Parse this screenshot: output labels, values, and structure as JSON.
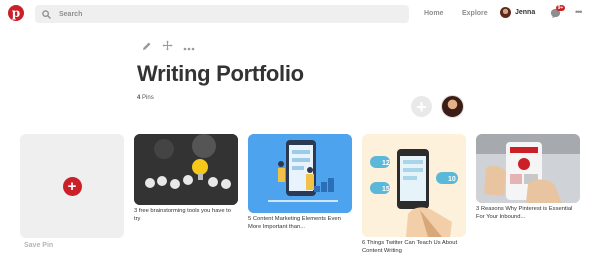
{
  "topbar": {
    "logo_letter": "p",
    "search_placeholder": "Search",
    "nav_home": "Home",
    "nav_explore": "Explore",
    "user_name": "Jenna",
    "notification_count": "9+",
    "more_glyph": "•••"
  },
  "board": {
    "title": "Writing Portfolio",
    "pin_count": "4",
    "pin_word": "Pins",
    "add_glyph": "+"
  },
  "save_card": {
    "plus_glyph": "+",
    "label": "Save Pin"
  },
  "pins": [
    {
      "caption": "3 free brainstorming tools you have to try"
    },
    {
      "caption": "5 Content Marketing Elements Even More Important than..."
    },
    {
      "caption": "6 Things Twitter Can Teach Us About Content Writing"
    },
    {
      "caption": "3 Reasons Why Pinterest is Essential For Your Inbound..."
    }
  ],
  "pin_image_texts": {
    "retweets": "12",
    "shares": "15",
    "likes": "10"
  },
  "colors": {
    "brand_red": "#cb2027",
    "muted_gray": "#8e8e8e",
    "field_gray": "#efefef",
    "content_marketing_blue": "#4ea3ee",
    "twitter_blue": "#5bb8d9"
  },
  "icons": [
    "pinterest-logo-icon",
    "search-icon",
    "user-avatar",
    "speech-bubble-icon",
    "more-icon",
    "pencil-icon",
    "move-arrows-icon",
    "more-options-icon",
    "plus-icon"
  ]
}
